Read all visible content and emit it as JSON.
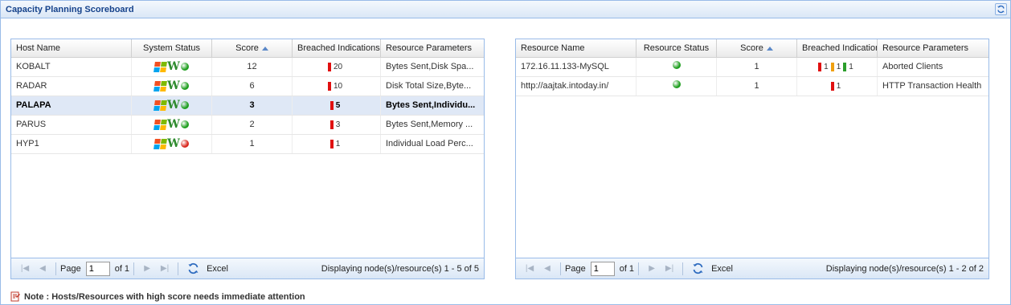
{
  "panel": {
    "title": "Capacity Planning Scoreboard"
  },
  "colors": {
    "green": "#1d9e1d",
    "red": "#d9261c",
    "orange": "#f0a010",
    "bar_red": "#e01010",
    "bar_green": "#2b9e2b"
  },
  "hosts": {
    "columns": [
      "Host Name",
      "System Status",
      "Score",
      "Breached Indications",
      "Resource Parameters"
    ],
    "rows": [
      {
        "name": "KOBALT",
        "status": "green",
        "score": "12",
        "breached": "20",
        "params": "Bytes Sent,Disk Spa...",
        "selected": false
      },
      {
        "name": "RADAR",
        "status": "green",
        "score": "6",
        "breached": "10",
        "params": "Disk Total Size,Byte...",
        "selected": false
      },
      {
        "name": "PALAPA",
        "status": "green",
        "score": "3",
        "breached": "5",
        "params": "Bytes Sent,Individu...",
        "selected": true
      },
      {
        "name": "PARUS",
        "status": "green",
        "score": "2",
        "breached": "3",
        "params": "Bytes Sent,Memory ...",
        "selected": false
      },
      {
        "name": "HYP1",
        "status": "red",
        "score": "1",
        "breached": "1",
        "params": "Individual Load Perc...",
        "selected": false
      }
    ],
    "pager": {
      "page_label": "Page",
      "page_value": "1",
      "of_label": "of 1",
      "excel_label": "Excel",
      "display": "Displaying node(s)/resource(s) 1 - 5 of 5"
    }
  },
  "resources": {
    "columns": [
      "Resource Name",
      "Resource Status",
      "Score",
      "Breached Indications",
      "Resource Parameters"
    ],
    "rows": [
      {
        "name": "172.16.11.133-MySQL",
        "status": "green",
        "score": "1",
        "breached": [
          {
            "color": "red",
            "value": "1"
          },
          {
            "color": "orange",
            "value": "1"
          },
          {
            "color": "green",
            "value": "1"
          }
        ],
        "params": "Aborted Clients"
      },
      {
        "name": "http://aajtak.intoday.in/",
        "status": "green",
        "score": "1",
        "breached": [
          {
            "color": "red",
            "value": "1"
          }
        ],
        "params": "HTTP Transaction Health"
      }
    ],
    "pager": {
      "page_label": "Page",
      "page_value": "1",
      "of_label": "of 1",
      "excel_label": "Excel",
      "display": "Displaying node(s)/resource(s) 1 - 2 of 2"
    }
  },
  "note": {
    "text": "Note : Hosts/Resources with high score needs immediate attention"
  }
}
